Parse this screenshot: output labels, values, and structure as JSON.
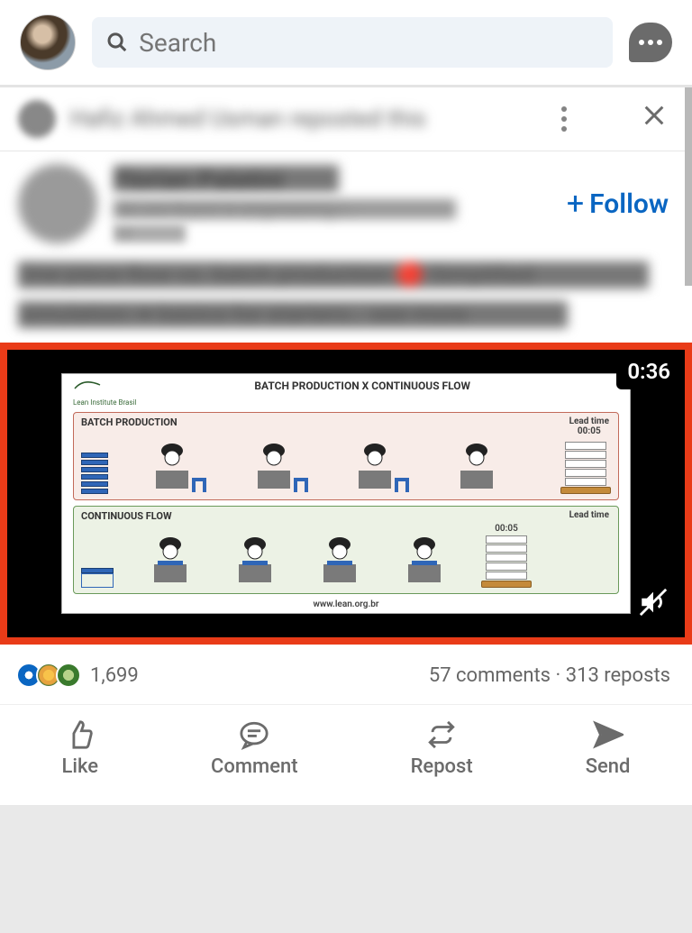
{
  "topbar": {
    "search_placeholder": "Search"
  },
  "repost": {
    "text": "Hafiz Ahmed Usman reposted this"
  },
  "author": {
    "name": "Florian Palatini",
    "sub": "We are fluent in engineering I…",
    "time": "1d",
    "follow_label": "Follow"
  },
  "post": {
    "line1": "One piece flow vs. batch production 🔴 Simplified",
    "line2": "simulation ➔ basics for starters… see more"
  },
  "video": {
    "duration": "0:36",
    "title": "BATCH PRODUCTION  X  CONTINUOUS FLOW",
    "batch_label": "BATCH PRODUCTION",
    "cont_label": "CONTINUOUS FLOW",
    "lead_time_label": "Lead time",
    "batch_lead_time": "00:05",
    "cont_lead_time": "00:05",
    "logo_text": "Lean Institute Brasil",
    "url": "www.lean.org.br"
  },
  "metrics": {
    "reactions_count": "1,699",
    "comments": "57 comments",
    "reposts": "313 reposts"
  },
  "actions": {
    "like": "Like",
    "comment": "Comment",
    "repost": "Repost",
    "send": "Send"
  }
}
